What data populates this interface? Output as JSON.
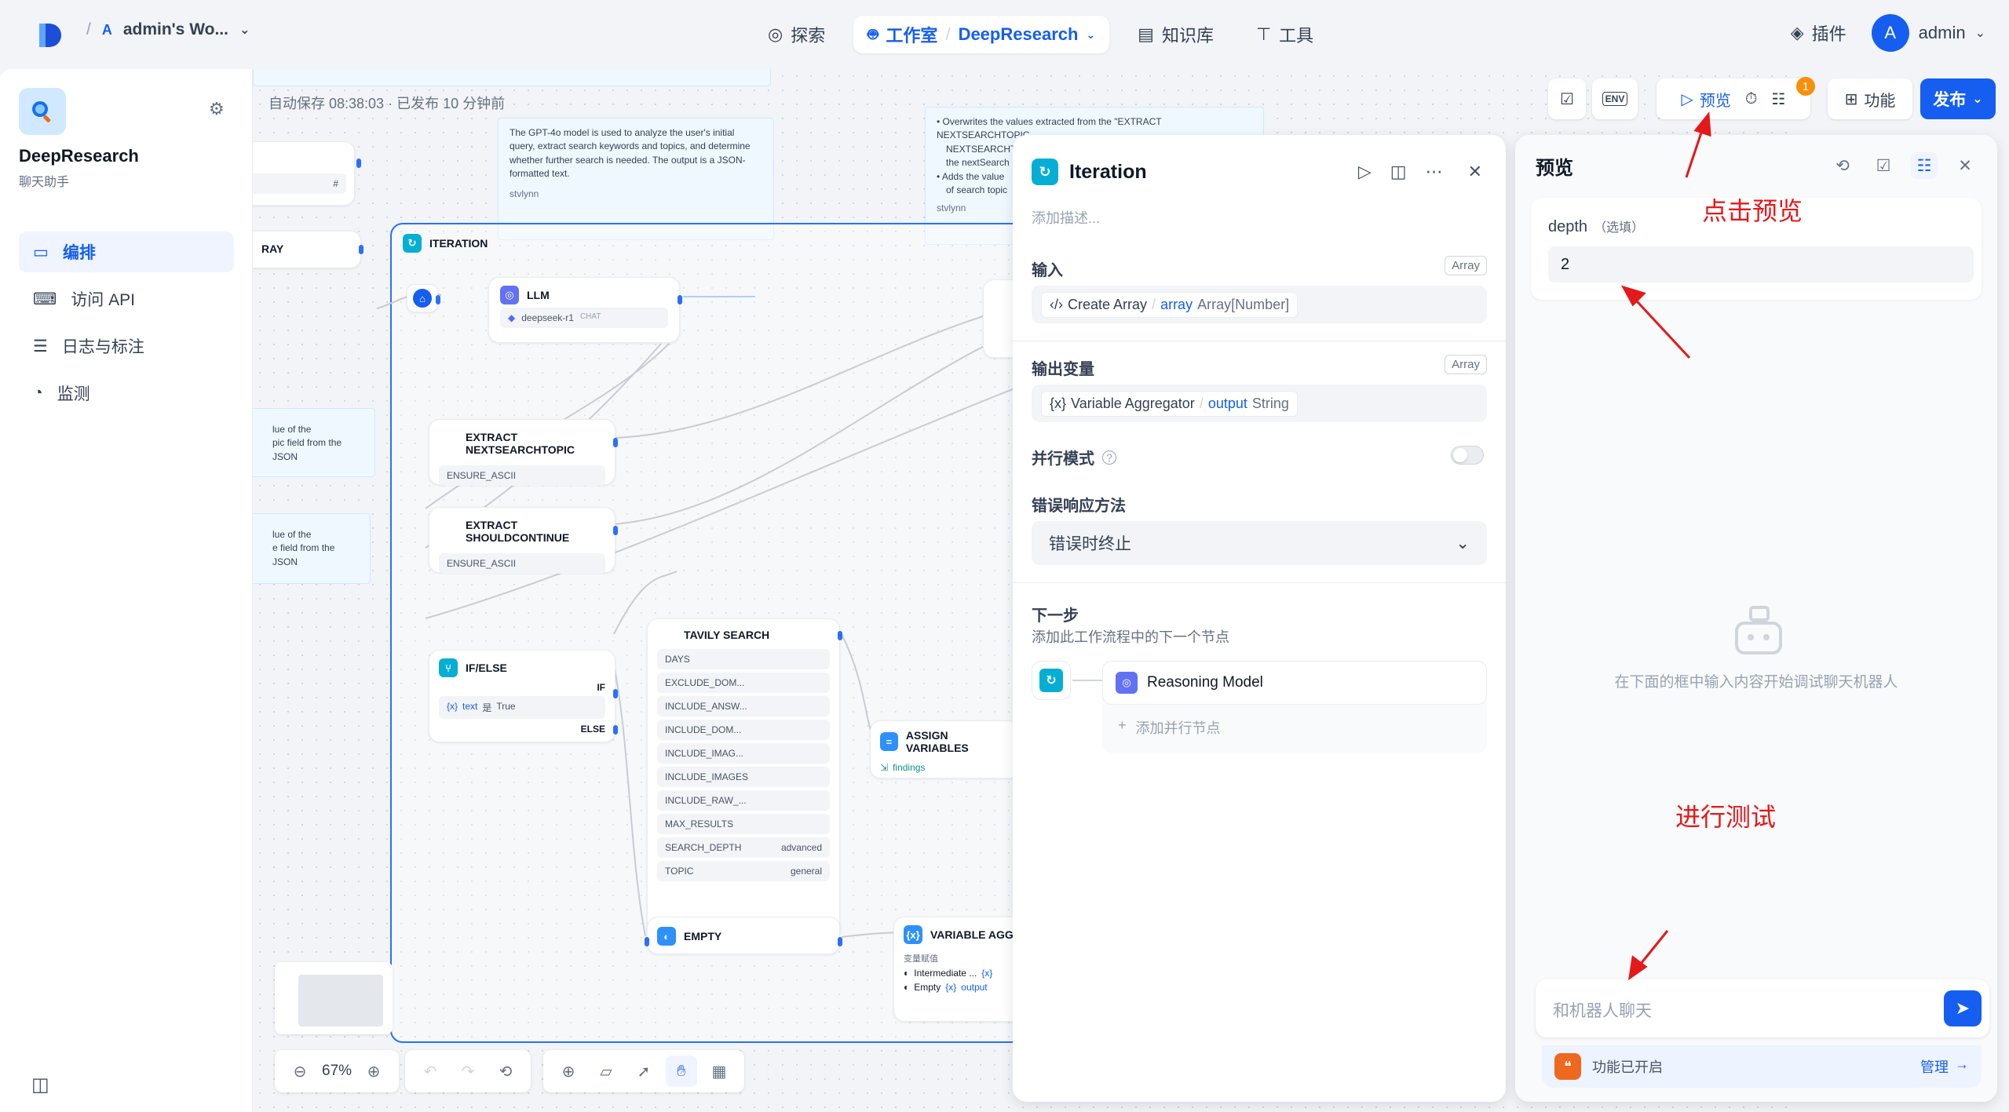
{
  "header": {
    "workspace_initial": "A",
    "workspace_name": "admin's Wo...",
    "nav": {
      "explore": "探索",
      "studio": "工作室",
      "app": "DeepResearch",
      "knowledge": "知识库",
      "tools": "工具"
    },
    "plugins": "插件",
    "user_initial": "A",
    "user_name": "admin"
  },
  "sidebar": {
    "app_name": "DeepResearch",
    "app_type": "聊天助手",
    "items": [
      {
        "label": "编排"
      },
      {
        "label": "访问 API"
      },
      {
        "label": "日志与标注"
      },
      {
        "label": "监测"
      }
    ]
  },
  "canvas": {
    "autosave": "自动保存 08:38:03 · 已发布 10 分钟前",
    "notes": {
      "gpt": "The GPT-4o model is used to analyze the user's initial query, extract search keywords and topics, and determine whether further search is needed. The output is a JSON-formatted text.",
      "gpt_author": "stvlynn",
      "overwrite_1": "Overwrites the values extracted from the \"EXTRACT NEXTSEARCHTOPIC",
      "overwrite_2": "the nextSearch",
      "overwrite_3": "Adds the value",
      "overwrite_4": "of search topic",
      "overwrite_author": "stvlynn",
      "left_1a": "lue of the",
      "left_1b": "pic field from the JSON",
      "left_2a": "lue of the",
      "left_2b": "e field from the JSON"
    },
    "partial_top_field": "#",
    "partial_array": "RAY",
    "iteration_label": "ITERATION",
    "llm": {
      "title": "LLM",
      "model": "deepseek-r1",
      "mode": "CHAT"
    },
    "extract_topic": {
      "title": "EXTRACT NEXTSEARCHTOPIC",
      "field": "ENSURE_ASCII"
    },
    "extract_continue": {
      "title": "EXTRACT SHOULDCONTINUE",
      "field": "ENSURE_ASCII"
    },
    "ifelse": {
      "title": "IF/ELSE",
      "if": "IF",
      "cond_var": "text",
      "cond_op": "是",
      "cond_val": "True",
      "else": "ELSE"
    },
    "tavily": {
      "title": "TAVILY SEARCH",
      "fields": [
        {
          "k": "DAYS",
          "v": ""
        },
        {
          "k": "EXCLUDE_DOM...",
          "v": ""
        },
        {
          "k": "INCLUDE_ANSW...",
          "v": ""
        },
        {
          "k": "INCLUDE_DOM...",
          "v": ""
        },
        {
          "k": "INCLUDE_IMAG...",
          "v": ""
        },
        {
          "k": "INCLUDE_IMAGES",
          "v": ""
        },
        {
          "k": "INCLUDE_RAW_...",
          "v": ""
        },
        {
          "k": "MAX_RESULTS",
          "v": ""
        },
        {
          "k": "SEARCH_DEPTH",
          "v": "advanced"
        },
        {
          "k": "TOPIC",
          "v": "general"
        }
      ]
    },
    "assign": {
      "title": "ASSIGN VARIABLES",
      "var": "findings"
    },
    "empty": {
      "title": "EMPTY"
    },
    "aggregator": {
      "title": "VARIABLE AGGRE",
      "sub": "变量赋值",
      "r1": "Intermediate ...",
      "r2": "Empty",
      "r2_out": "output"
    },
    "zoom": "67%"
  },
  "iteration_panel": {
    "title": "Iteration",
    "desc_placeholder": "添加描述...",
    "input_label": "输入",
    "input_type": "Array",
    "input_node": "Create Array",
    "input_var": "array",
    "input_vartype": "Array[Number]",
    "output_label": "输出变量",
    "output_type": "Array",
    "output_node": "Variable Aggregator",
    "output_var": "output",
    "output_vartype": "String",
    "parallel_label": "并行模式",
    "parallel_enabled": false,
    "error_label": "错误响应方法",
    "error_value": "错误时终止",
    "next_label": "下一步",
    "next_desc": "添加此工作流程中的下一个节点",
    "next_node": "Reasoning Model",
    "add_parallel": "添加并行节点"
  },
  "actions": {
    "env": "ENV",
    "preview": "预览",
    "checklist_count": "1",
    "features": "功能",
    "publish": "发布"
  },
  "preview": {
    "title": "预览",
    "depth_label": "depth",
    "depth_optional": "（选填）",
    "depth_value": "2",
    "empty_hint": "在下面的框中输入内容开始调试聊天机器人",
    "chat_placeholder": "和机器人聊天",
    "features_enabled": "功能已开启",
    "manage": "管理"
  },
  "annotations": {
    "click_preview": "点击预览",
    "run_test": "进行测试"
  },
  "colors": {
    "accent": "#155eef",
    "annotation": "#e5181b",
    "badge": "#f79009"
  }
}
